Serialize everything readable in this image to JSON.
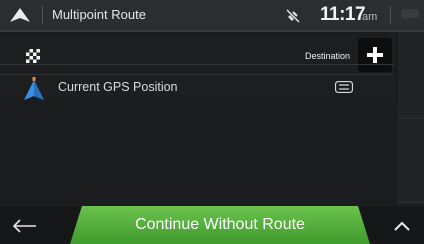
{
  "header": {
    "title": "Multipoint Route",
    "time": "11:17",
    "ampm": "am"
  },
  "route": {
    "destination_label": "Destination",
    "start_label": "Current GPS Position"
  },
  "footer": {
    "continue_label": "Continue Without Route"
  },
  "icons": {
    "top_left": "navigation-arrow-icon",
    "satellite": "satellite-off-icon",
    "messages": "chat-bubble-icon",
    "add": "plus-icon",
    "destination": "checkered-flag-icon",
    "gps": "gps-arrow-icon",
    "details": "list-icon",
    "back": "back-arrow-icon",
    "expand": "chevron-up-icon"
  },
  "colors": {
    "accent_green": "#5db43f",
    "route_orange": "#f08a2a",
    "gps_blue": "#3a8ee6"
  }
}
